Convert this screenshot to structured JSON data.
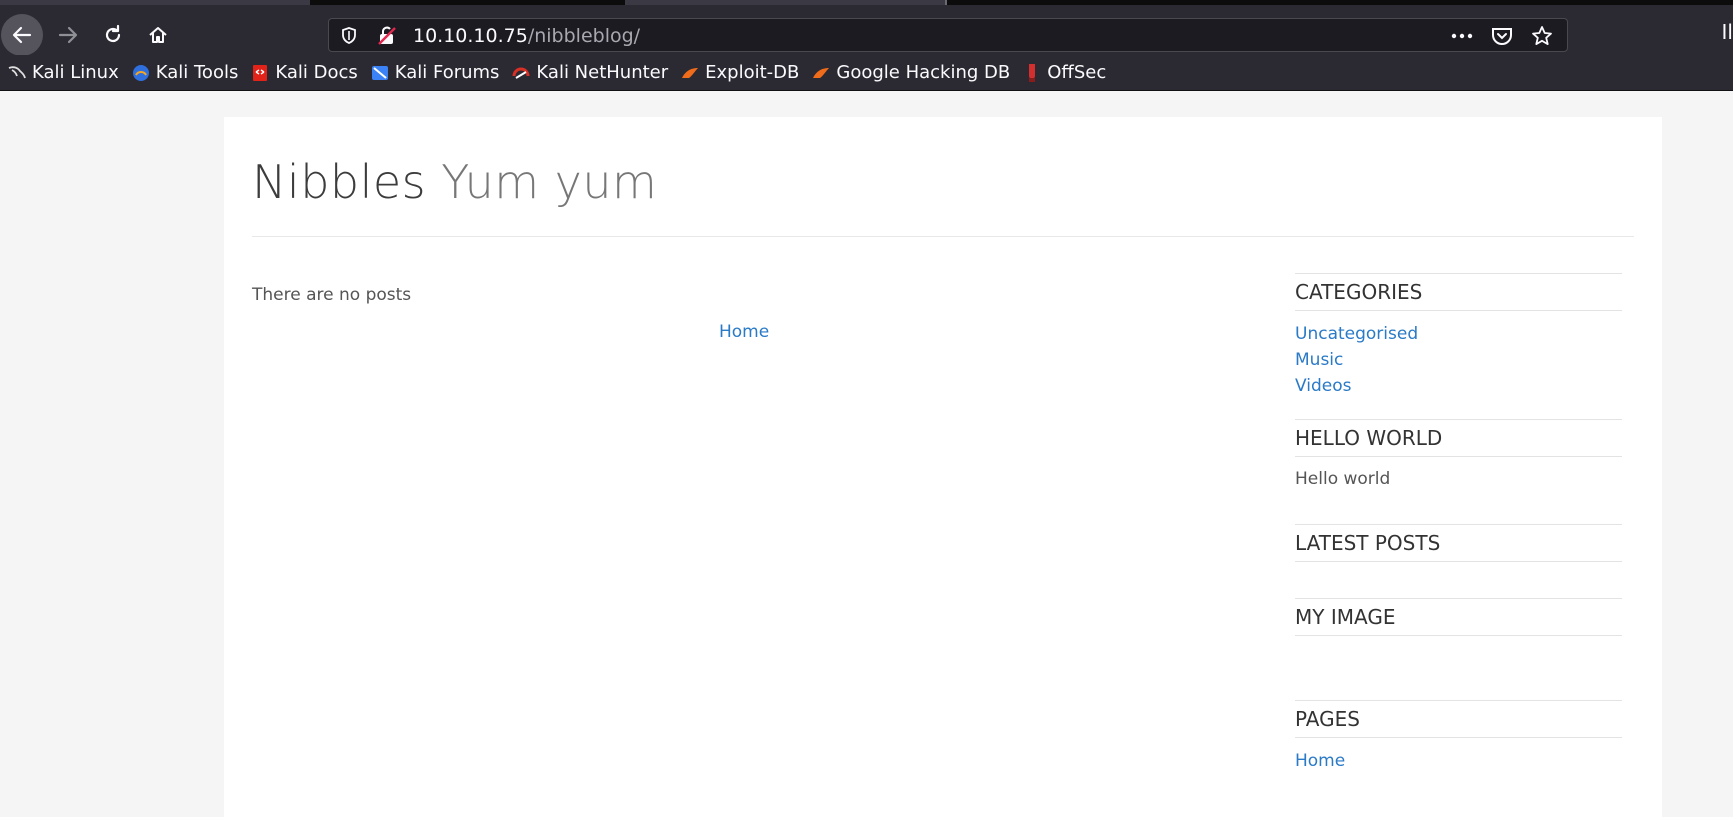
{
  "browser": {
    "url_host": "10.10.10.75",
    "url_path": "/nibbleblog/",
    "edge_glyph": "Il",
    "icons": {
      "back": "arrow-left-icon",
      "forward": "arrow-right-icon",
      "reload": "reload-icon",
      "home": "home-icon",
      "tracking": "shield-icon",
      "insecure": "broken-lock-icon",
      "more": "more-dots-icon",
      "pocket": "pocket-icon",
      "bookmark": "star-icon"
    },
    "colors": {
      "toolbar": "#2b2a33",
      "urlbar": "#1c1b22",
      "text": "#fbfbfe"
    }
  },
  "bookmarks": [
    {
      "label": "Kali Linux",
      "icon": "kali-dragon-icon",
      "color": "#e0e0e0"
    },
    {
      "label": "Kali Tools",
      "icon": "kali-tools-icon",
      "color": "#2f6fde"
    },
    {
      "label": "Kali Docs",
      "icon": "kali-docs-icon",
      "color": "#e2231a"
    },
    {
      "label": "Kali Forums",
      "icon": "kali-forums-icon",
      "color": "#3b82f6"
    },
    {
      "label": "Kali NetHunter",
      "icon": "nethunter-icon",
      "color": "#d93025"
    },
    {
      "label": "Exploit-DB",
      "icon": "exploit-db-icon",
      "color": "#f06b1a"
    },
    {
      "label": "Google Hacking DB",
      "icon": "ghdb-icon",
      "color": "#f06b1a"
    },
    {
      "label": "OffSec",
      "icon": "offsec-icon",
      "color": "#d32f2f"
    }
  ],
  "site": {
    "name": "Nibbles",
    "slogan": "Yum yum",
    "no_posts": "There are no posts",
    "pager_home": "Home",
    "link_color": "#2a7ac7"
  },
  "sidebar": {
    "categories": {
      "title": "CATEGORIES",
      "items": [
        "Uncategorised",
        "Music",
        "Videos"
      ]
    },
    "hello_world": {
      "title": "HELLO WORLD",
      "text": "Hello world"
    },
    "latest_posts": {
      "title": "LATEST POSTS"
    },
    "my_image": {
      "title": "MY IMAGE"
    },
    "pages": {
      "title": "PAGES",
      "items": [
        "Home"
      ]
    }
  }
}
